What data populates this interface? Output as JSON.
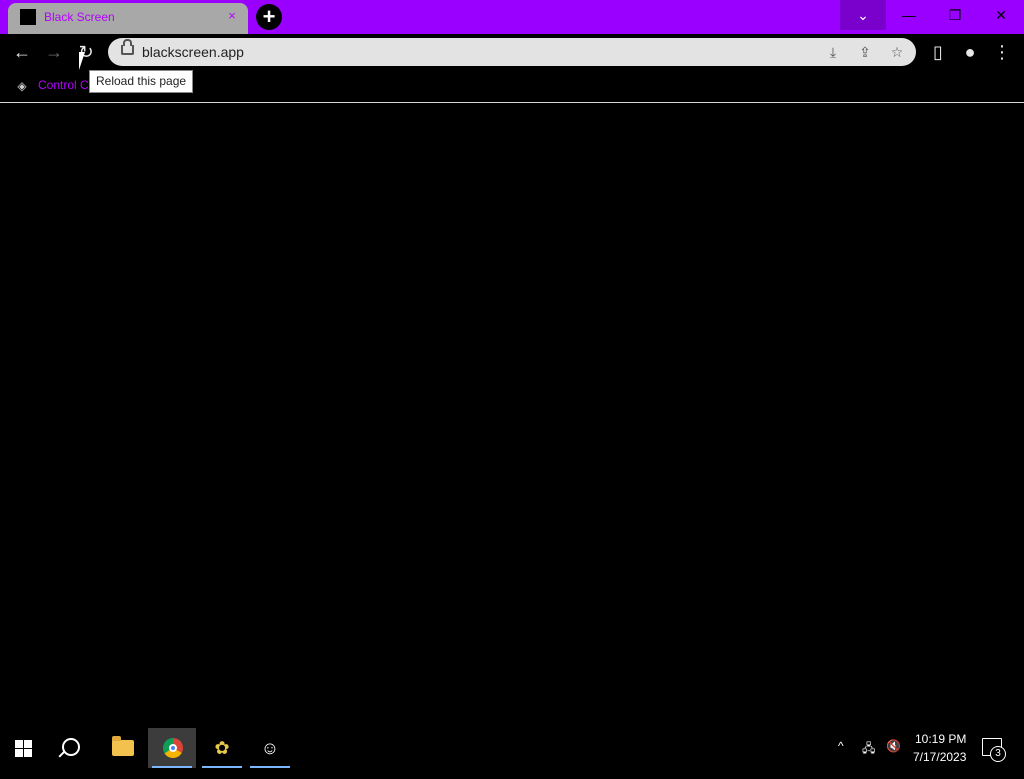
{
  "browser": {
    "tab": {
      "title": "Black Screen",
      "close_glyph": "×",
      "favicon": "black-square-icon"
    },
    "new_tab_glyph": "+",
    "window_controls": {
      "tab_search": "⌄",
      "minimize": "—",
      "restore": "❐",
      "close": "✕"
    },
    "toolbar": {
      "back": "←",
      "forward": "→",
      "reload": "↻",
      "url": "blackscreen.app",
      "download_glyph": "⤓",
      "share_glyph": "⇪",
      "star_glyph": "☆",
      "side_panel_glyph": "▯",
      "profile_glyph": "●",
      "menu_glyph": "⋮"
    },
    "bookmarks": [
      {
        "label": "Control C",
        "icon": "control-center-icon"
      }
    ],
    "tooltip": "Reload this page",
    "colors": {
      "frame": "#9a00ff",
      "tab_text": "#b400ff",
      "page": "#000000"
    }
  },
  "taskbar": {
    "apps": [
      "start-icon",
      "search-icon",
      "file-explorer-icon",
      "chrome-icon",
      "bee-app-icon",
      "cartoon-app-icon"
    ],
    "tray": {
      "chevron": "^",
      "network": "🖧",
      "volume": "🔇"
    },
    "time": "10:19 PM",
    "date": "7/17/2023",
    "notification_count": "3"
  }
}
